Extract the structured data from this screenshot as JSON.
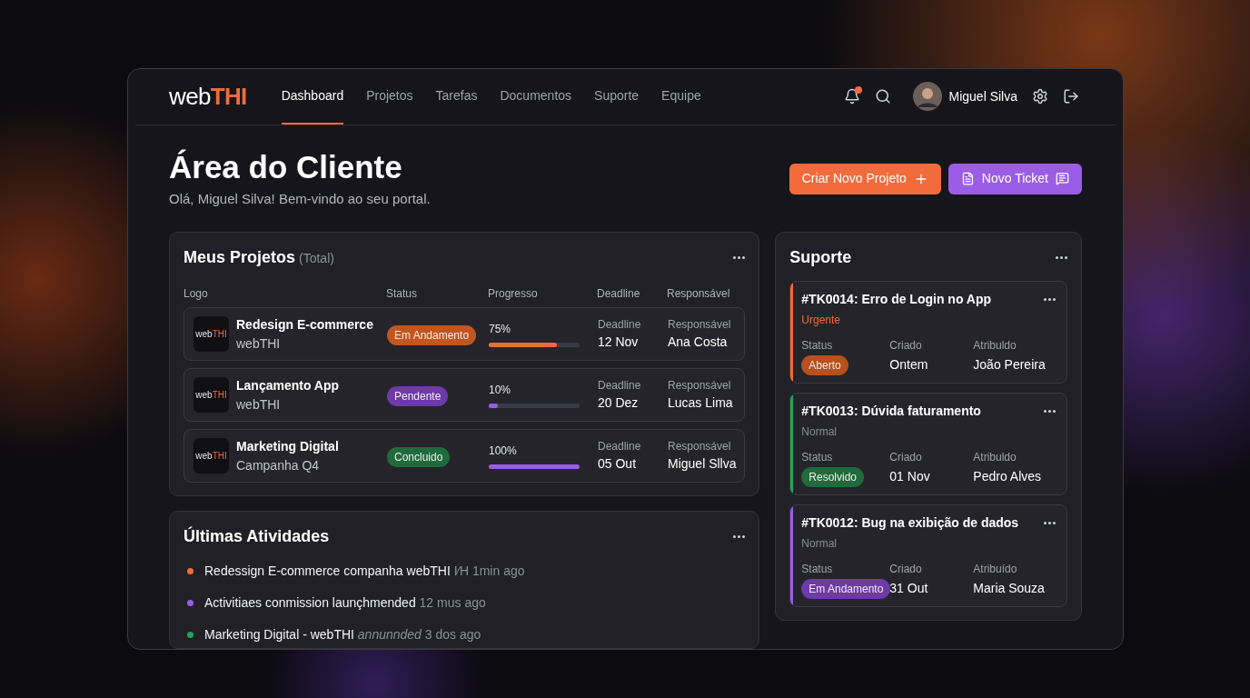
{
  "brand": {
    "first": "web",
    "second": "THI"
  },
  "nav": [
    {
      "label": "Dashboard",
      "selected": true
    },
    {
      "label": "Projetos",
      "selected": false
    },
    {
      "label": "Tarefas",
      "selected": false
    },
    {
      "label": "Documentos",
      "selected": false
    },
    {
      "label": "Suporte",
      "selected": false
    },
    {
      "label": "Equipe",
      "selected": false
    }
  ],
  "notifications": {
    "has_unread": true
  },
  "user": {
    "name": "Miguel Silva"
  },
  "page": {
    "title": "Área do Cliente",
    "subtitle": "Olá, Miguel Silva! Bem-vindo ao seu portal."
  },
  "actions": [
    {
      "label": "Criar Novo Projeto",
      "kind": "create"
    },
    {
      "label": "Novo Ticket",
      "kind": "ticket"
    }
  ],
  "projects": {
    "title": "Meus Projetos",
    "suffix": "(Total)",
    "columns": [
      "Logo",
      "Status",
      "Progresso",
      "Deadline",
      "Responsável"
    ],
    "rows": [
      {
        "logo": {
          "first": "web",
          "second": "THI"
        },
        "name": "Redesign E-commerce",
        "client": "webTHI",
        "status": {
          "label": "Em Andamento",
          "color": "#c2561f"
        },
        "progress": "75%",
        "level": 0.75,
        "color": "#f26b3a",
        "deadline_label": "Deadline",
        "deadline": "12 Nov",
        "owner_label": "Responsável",
        "owner": "Ana Costa"
      },
      {
        "logo": {
          "first": "web",
          "second": "THI"
        },
        "name": "Lançamento App",
        "client": "webTHI",
        "status": {
          "label": "Pendente",
          "color": "#6d3aa8"
        },
        "progress": "10%",
        "level": 0.1,
        "color": "#9b5de5",
        "deadline_label": "Deadline",
        "deadline": "20 Dez",
        "owner_label": "Responsável",
        "owner": "Lucas Lima"
      },
      {
        "logo": {
          "first": "web",
          "second": "THI"
        },
        "name": "Marketing Digital",
        "client": "Campanha Q4",
        "status": {
          "label": "Concluido",
          "color": "#1f6b3b"
        },
        "progress": "100%",
        "level": 1,
        "color": "#9b5de5",
        "deadline_label": "Deadline",
        "deadline": "05 Out",
        "owner_label": "Responsável",
        "owner": "Miguel Sllva"
      }
    ]
  },
  "activities": {
    "title": "Últimas Atividades",
    "items": [
      {
        "text": "Redessign E-commerce companha webTHI",
        "meta": "I⁄H 1min ago",
        "color": "#f26b3a"
      },
      {
        "text": "Activitiaes conmission launçhmended",
        "meta": "12 mus ago",
        "color": "#9b5de5"
      },
      {
        "text": "Marketing Digital - webTHI",
        "meta": "*annunnded* 3 dos ago",
        "color": "#22a35a"
      }
    ]
  },
  "support": {
    "title": "Suporte",
    "tickets": [
      {
        "title": "#TK0014: Erro de Login no App",
        "priority": {
          "label": "Urgente",
          "color": "#f26b3a"
        },
        "color": "#f26b3a",
        "status_label": "Status",
        "status": {
          "label": "Aberto",
          "color": "#b8501c"
        },
        "created_label": "Criado",
        "created": "Ontem",
        "assigned_label": "Atribuldo",
        "assigned": "João Pereira"
      },
      {
        "title": "#TK0013: Dúvida faturamento",
        "priority": {
          "label": "Normal",
          "color": "#8a8d96"
        },
        "color": "#22a35a",
        "status_label": "Status",
        "status": {
          "label": "Resolvido",
          "color": "#1f6b3b"
        },
        "created_label": "Criado",
        "created": "01 Nov",
        "assigned_label": "Atribuldo",
        "assigned": "Pedro Alves"
      },
      {
        "title": "#TK0012: Bug na exibição de dados",
        "priority": {
          "label": "Normal",
          "color": "#8a8d96"
        },
        "color": "#9b5de5",
        "status_label": "Status",
        "status": {
          "label": "Em Andamento",
          "color": "#6d3aa8"
        },
        "created_label": "Criado",
        "created": "31 Out",
        "assigned_label": "Atribuído",
        "assigned": "Maria Souza"
      }
    ]
  }
}
